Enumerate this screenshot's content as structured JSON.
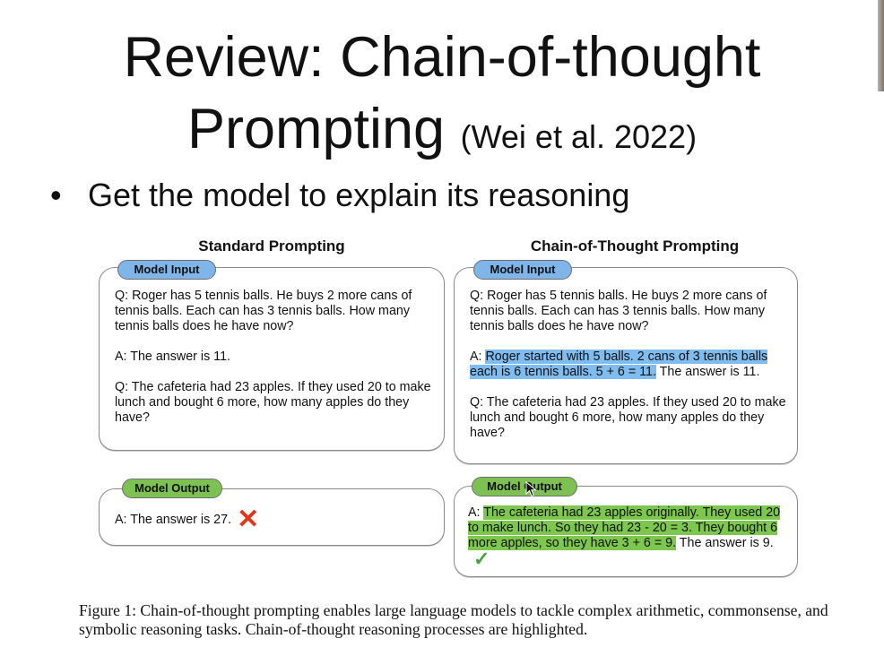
{
  "slide": {
    "title_line1": "Review: Chain-of-thought",
    "title_line2_main": "Prompting",
    "title_line2_citation": "(Wei et al. 2022)",
    "bullet": "Get the model to explain its reasoning"
  },
  "figure": {
    "standard": {
      "heading": "Standard Prompting",
      "input_label": "Model Input",
      "input_q1": "Q: Roger has 5 tennis balls. He buys 2 more cans of tennis balls. Each can has 3 tennis balls. How many tennis balls does he have now?",
      "input_a1": "A: The answer is 11.",
      "input_q2": "Q: The cafeteria had 23 apples. If they used 20 to make lunch and bought 6 more, how many apples do they have?",
      "output_label": "Model Output",
      "output_text": "A: The answer is 27."
    },
    "cot": {
      "heading": "Chain-of-Thought Prompting",
      "input_label": "Model Input",
      "input_q1": "Q: Roger has 5 tennis balls. He buys 2 more cans of tennis balls. Each can has 3 tennis balls. How many tennis balls does he have now?",
      "input_a1_prefix": "A: ",
      "input_a1_reasoning": "Roger started with 5 balls. 2 cans of 3 tennis balls each is 6 tennis balls. 5 + 6 = 11.",
      "input_a1_suffix": " The answer is 11.",
      "input_q2": "Q: The cafeteria had 23 apples. If they used 20 to make lunch and bought 6 more, how many apples do they have?",
      "output_label": "Model Output",
      "output_prefix": "A: ",
      "output_reasoning": "The cafeteria had 23 apples originally. They used 20 to make lunch. So they had 23 - 20 = 3. They bought 6 more apples, so they have 3 + 6 = 9.",
      "output_suffix": " The answer is 9."
    },
    "caption": "Figure 1: Chain-of-thought prompting enables large language models to tackle complex arithmetic, commonsense, and symbolic reasoning tasks. Chain-of-thought reasoning processes are highlighted."
  },
  "icons": {
    "wrong": "cross-icon",
    "correct": "check-icon",
    "pointer": "cursor-icon"
  },
  "colors": {
    "input_label_bg": "#7fb5e9",
    "output_label_bg": "#7dc153",
    "highlight_blue": "#7fbcef",
    "highlight_green": "#7dc74e",
    "cross": "#e2361a",
    "check": "#48a43e"
  }
}
